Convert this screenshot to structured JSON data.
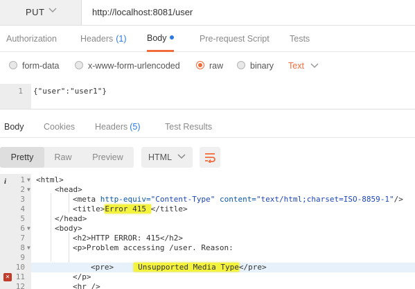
{
  "request": {
    "method": "PUT",
    "url": "http://localhost:8081/user"
  },
  "request_tabs": [
    {
      "label": "Authorization"
    },
    {
      "label": "Headers",
      "count": "(1)"
    },
    {
      "label": "Body"
    },
    {
      "label": "Pre-request Script"
    },
    {
      "label": "Tests"
    }
  ],
  "body_types": [
    "form-data",
    "x-www-form-urlencoded",
    "raw",
    "binary"
  ],
  "body_format": "Text",
  "request_body": {
    "line": "1",
    "code": "{\"user\":\"user1\"}"
  },
  "response_tabs": [
    {
      "label": "Body"
    },
    {
      "label": "Cookies"
    },
    {
      "label": "Headers",
      "count": "(5)"
    },
    {
      "label": "Test Results"
    }
  ],
  "view_modes": [
    "Pretty",
    "Raw",
    "Preview"
  ],
  "response_format": "HTML",
  "response_lines": {
    "l1": {
      "num": "1",
      "tag": "<html>"
    },
    "l2": {
      "num": "2",
      "tag": "<head>"
    },
    "l3": {
      "num": "3",
      "open": "<meta",
      "a1": "http-equiv=",
      "v1": "\"Content-Type\"",
      "a2": "content=",
      "v2": "\"text/html;charset=ISO-8859-1\"",
      "close": "/>"
    },
    "l4": {
      "num": "4",
      "open": "<title>",
      "text": "Error 415 ",
      "close": "</title>"
    },
    "l5": {
      "num": "5",
      "tag": "</head>"
    },
    "l6": {
      "num": "6",
      "tag": "<body>"
    },
    "l7": {
      "num": "7",
      "text": "<h2>HTTP ERROR: 415</h2>"
    },
    "l8": {
      "num": "8",
      "text": "<p>Problem accessing /user. Reason:"
    },
    "l9": {
      "num": "9"
    },
    "l10": {
      "num": "10",
      "open": "<pre>",
      "text": "Unsupported Media Type",
      "close": "</pre>"
    },
    "l11": {
      "num": "11",
      "tag": "</p>"
    },
    "l12": {
      "num": "12",
      "tag": "<hr />"
    }
  },
  "colors": {
    "accent": "#f26b3a",
    "link": "#2a7ae2",
    "highlight": "#f3f23d",
    "error": "#c23b2a"
  }
}
